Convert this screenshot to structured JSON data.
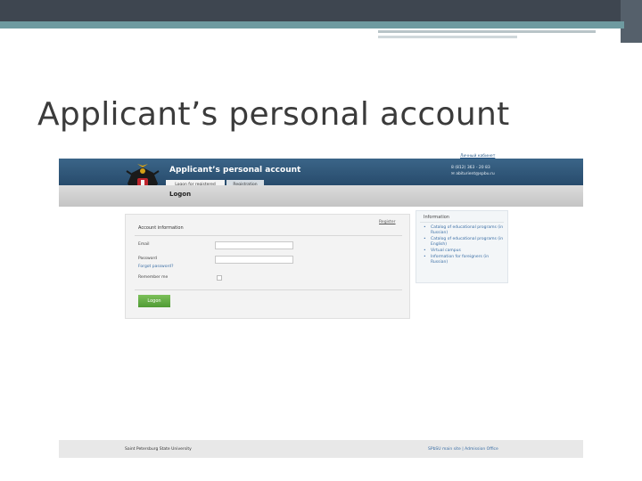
{
  "slide": {
    "title": "Applicant’s personal account"
  },
  "site": {
    "top_link": "Личный кабинет",
    "title": "Applicant’s personal account",
    "contact_line1": "8 (812) 363 - 20 83",
    "contact_line2": "✉ abiturient@spbu.ru",
    "tabs": [
      {
        "label": "Logon for registered",
        "active": true
      },
      {
        "label": "Registration",
        "active": false
      }
    ],
    "page_heading": "Logon"
  },
  "login": {
    "title": "Account information",
    "register_link": "Register",
    "email_label": "Email",
    "email_value": "",
    "password_label": "Password",
    "password_value": "",
    "forgot_link": "Forgot password?",
    "remember_label": "Remember me",
    "remember_checked": false,
    "button_label": "Logon"
  },
  "info": {
    "title": "Information",
    "items": [
      "Catalog of educational programs (in Russian)",
      "Catalog of educational programs (in English)",
      "Virtual campus",
      "Information for foreigners (in Russian)"
    ]
  },
  "footer": {
    "left_text": "Saint Petersburg State University",
    "right_text": "SPbSU main site | Admission Office"
  },
  "colors": {
    "header_blue": "#2a4f72",
    "button_green": "#5fab3f",
    "link_blue": "#3a6ea5",
    "teal_accent": "#6e9aa0"
  }
}
